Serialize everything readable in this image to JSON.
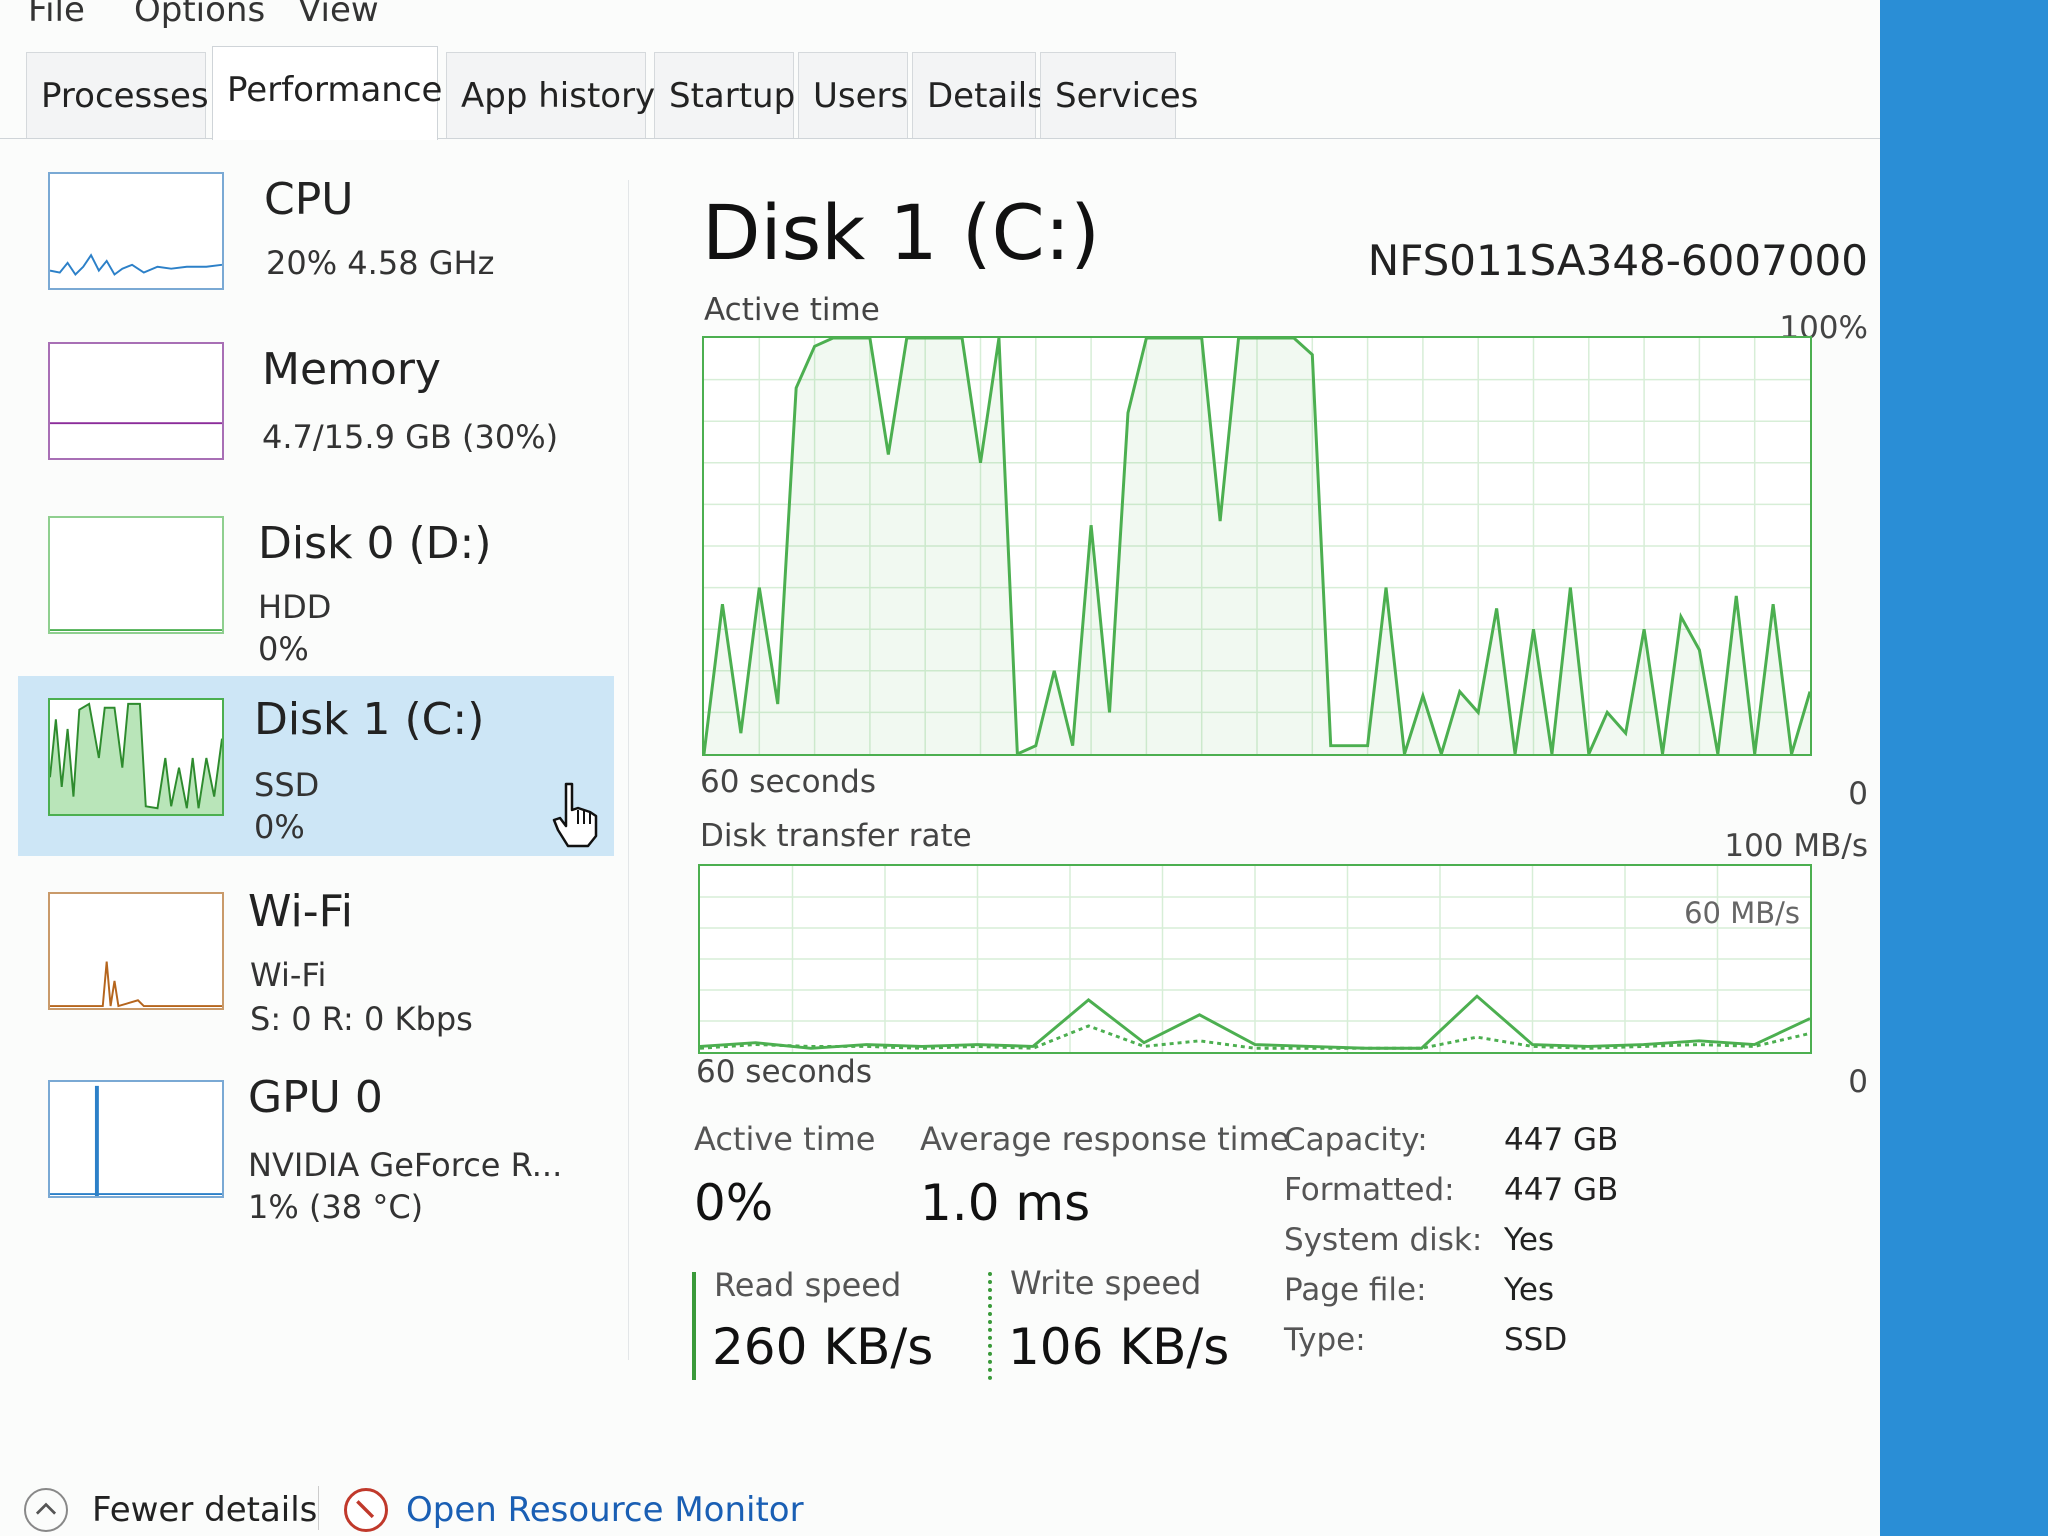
{
  "menu": [
    "File",
    "Options",
    "View"
  ],
  "tabs": [
    "Processes",
    "Performance",
    "App history",
    "Startup",
    "Users",
    "Details",
    "Services"
  ],
  "active_tab": "Performance",
  "sidebar": {
    "items": [
      {
        "title": "CPU",
        "sub1": "20% 4.58 GHz",
        "sub2": "",
        "color": "#2c80c8"
      },
      {
        "title": "Memory",
        "sub1": "4.7/15.9 GB (30%)",
        "sub2": "",
        "color": "#8b2c9a"
      },
      {
        "title": "Disk 0 (D:)",
        "sub1": "HDD",
        "sub2": "0%",
        "color": "#4caf50"
      },
      {
        "title": "Disk 1 (C:)",
        "sub1": "SSD",
        "sub2": "0%",
        "color": "#4caf50"
      },
      {
        "title": "Wi-Fi",
        "sub1": "Wi-Fi",
        "sub2": "S: 0 R: 0 Kbps",
        "color": "#b5651d"
      },
      {
        "title": "GPU 0",
        "sub1": "NVIDIA GeForce R...",
        "sub2": "1% (38 °C)",
        "color": "#2c80c8"
      }
    ],
    "selected_index": 3
  },
  "main": {
    "title": "Disk 1 (C:)",
    "model": "NFS011SA348-6007000",
    "active_graph": {
      "label": "Active time",
      "max_label": "100%",
      "time_label": "60 seconds",
      "min_label": "0"
    },
    "transfer_graph": {
      "label": "Disk transfer rate",
      "max_label": "100 MB/s",
      "mid_label": "60 MB/s",
      "time_label": "60 seconds",
      "min_label": "0"
    },
    "stats": {
      "active_time_label": "Active time",
      "active_time_value": "0%",
      "avg_response_label": "Average response time",
      "avg_response_value": "1.0 ms",
      "read_label": "Read speed",
      "read_value": "260 KB/s",
      "write_label": "Write speed",
      "write_value": "106 KB/s"
    },
    "properties": [
      {
        "label": "Capacity:",
        "value": "447 GB"
      },
      {
        "label": "Formatted:",
        "value": "447 GB"
      },
      {
        "label": "System disk:",
        "value": "Yes"
      },
      {
        "label": "Page file:",
        "value": "Yes"
      },
      {
        "label": "Type:",
        "value": "SSD"
      }
    ]
  },
  "footer": {
    "fewer_details": "Fewer details",
    "open_monitor": "Open Resource Monitor"
  },
  "colors": {
    "disk_accent": "#4caf50",
    "link": "#1a5fb4",
    "selection": "#cde6f6"
  },
  "chart_data": {
    "active_time": {
      "type": "line",
      "unit": "%",
      "ylim": [
        0,
        100
      ],
      "x_seconds_ago": [
        60,
        59,
        58,
        57,
        56,
        55,
        54,
        53,
        52,
        51,
        50,
        49,
        48,
        47,
        46,
        45,
        44,
        43,
        42,
        41,
        40,
        39,
        38,
        37,
        36,
        35,
        34,
        33,
        32,
        31,
        30,
        29,
        28,
        27,
        26,
        25,
        24,
        23,
        22,
        21,
        20,
        19,
        18,
        17,
        16,
        15,
        14,
        13,
        12,
        11,
        10,
        9,
        8,
        7,
        6,
        5,
        4,
        3,
        2,
        1,
        0
      ],
      "values": [
        0,
        36,
        5,
        40,
        12,
        88,
        98,
        100,
        100,
        100,
        72,
        100,
        100,
        100,
        100,
        70,
        100,
        0,
        2,
        20,
        2,
        55,
        10,
        82,
        100,
        100,
        100,
        100,
        56,
        100,
        100,
        100,
        100,
        96,
        2,
        2,
        2,
        40,
        0,
        14,
        0,
        15,
        10,
        35,
        0,
        30,
        0,
        40,
        0,
        10,
        5,
        30,
        0,
        33,
        25,
        0,
        38,
        0,
        36,
        0,
        15
      ],
      "series": [
        {
          "name": "Active time",
          "color": "#4caf50"
        }
      ]
    },
    "transfer_rate": {
      "type": "line",
      "unit": "MB/s",
      "ylim": [
        0,
        100
      ],
      "x_seconds_ago": [
        60,
        57,
        54,
        51,
        48,
        45,
        42,
        39,
        36,
        33,
        30,
        27,
        24,
        21,
        18,
        15,
        12,
        9,
        6,
        3,
        0
      ],
      "series": [
        {
          "name": "Read speed",
          "color": "#4caf50",
          "values": [
            3,
            5,
            2,
            4,
            3,
            4,
            3,
            28,
            5,
            20,
            4,
            3,
            2,
            2,
            30,
            4,
            3,
            4,
            6,
            4,
            18
          ]
        },
        {
          "name": "Write speed",
          "color": "#4caf50",
          "values": [
            2,
            4,
            3,
            3,
            2,
            3,
            2,
            14,
            3,
            6,
            2,
            2,
            2,
            2,
            8,
            3,
            2,
            3,
            4,
            3,
            10
          ]
        }
      ]
    }
  }
}
